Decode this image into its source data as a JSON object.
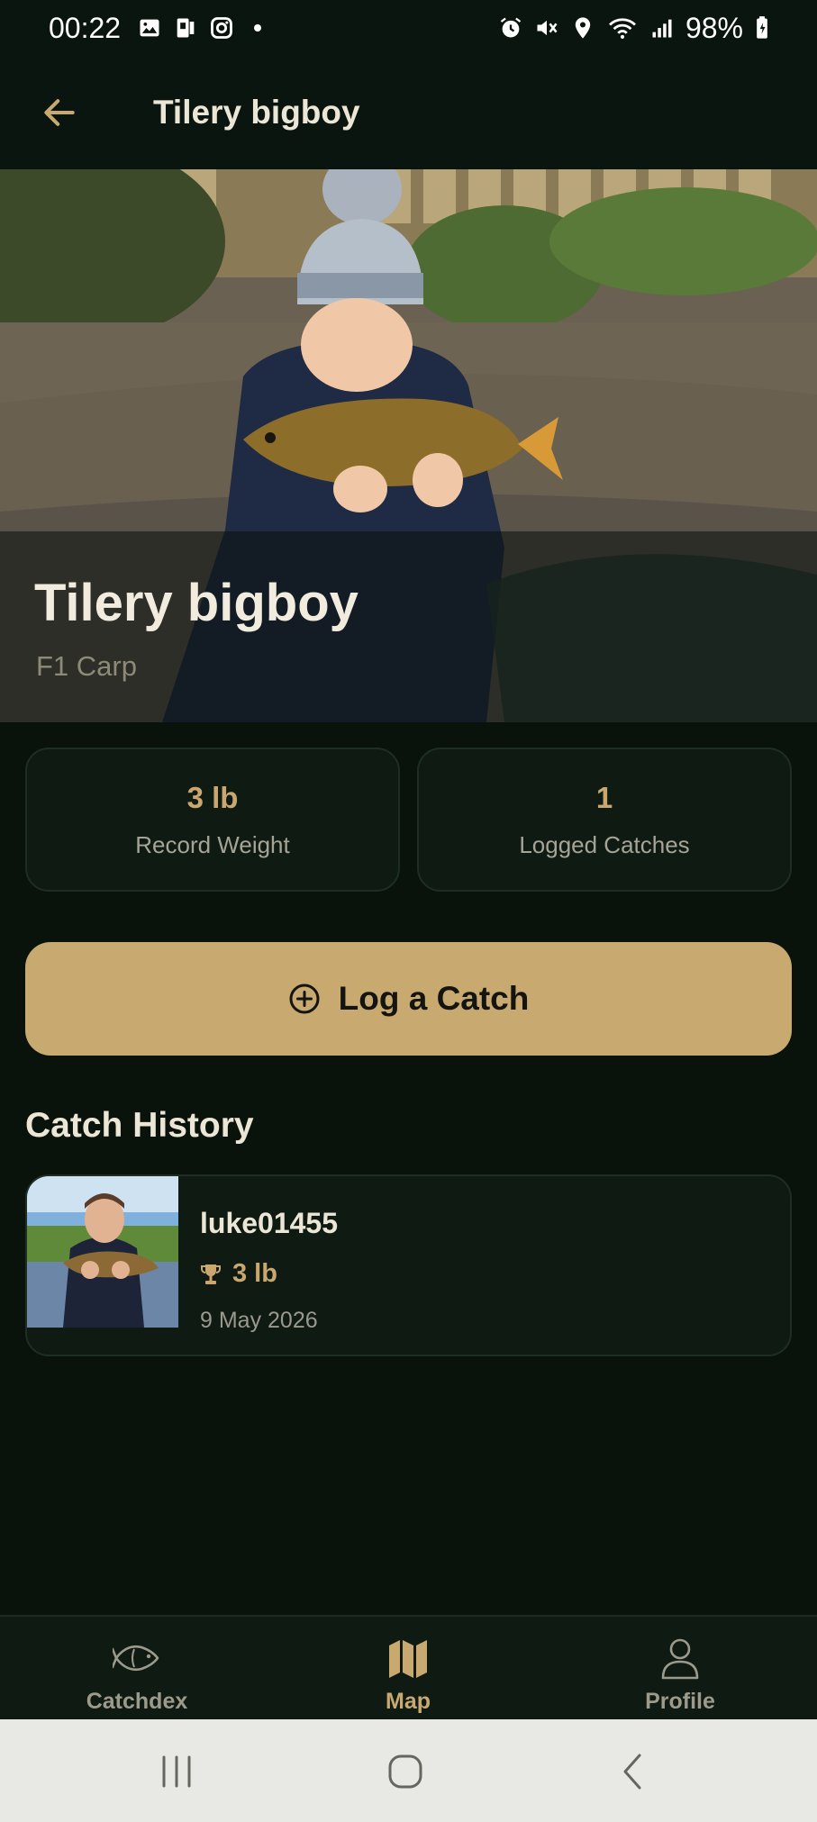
{
  "status_bar": {
    "time": "00:22",
    "battery": "98%",
    "left_icons": [
      "image-icon",
      "sim-icon",
      "instagram-icon",
      "dot-icon"
    ],
    "right_icons": [
      "alarm-icon",
      "mute-icon",
      "location-icon",
      "wifi-icon",
      "signal-icon",
      "battery-icon"
    ]
  },
  "header": {
    "title": "Tilery bigboy",
    "back_icon": "arrow-left-icon"
  },
  "hero": {
    "name": "Tilery bigboy",
    "species": "F1 Carp"
  },
  "stats": [
    {
      "value": "3 lb",
      "label": "Record Weight"
    },
    {
      "value": "1",
      "label": "Logged Catches"
    }
  ],
  "log_button": {
    "label": "Log a Catch",
    "icon": "plus-circle-icon"
  },
  "catch_history": {
    "title": "Catch History",
    "items": [
      {
        "user": "luke01455",
        "weight": "3 lb",
        "date": "9 May 2026",
        "icon": "trophy-icon"
      }
    ]
  },
  "bottom_nav": {
    "items": [
      {
        "label": "Catchdex",
        "icon": "fish-icon",
        "active": false
      },
      {
        "label": "Map",
        "icon": "map-icon",
        "active": true
      },
      {
        "label": "Profile",
        "icon": "person-icon",
        "active": false
      }
    ]
  },
  "colors": {
    "background": "#0a120c",
    "accent": "#c8a96f",
    "card": "#0f1b12",
    "text": "#ece6d6",
    "muted": "#a5a497",
    "inactive_nav": "#9b9a8b"
  }
}
